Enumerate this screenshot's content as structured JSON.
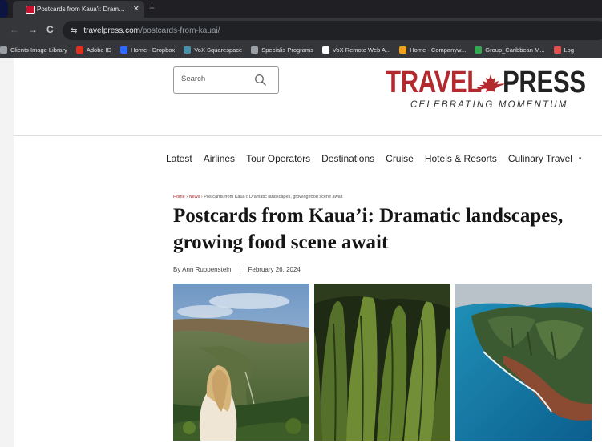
{
  "browser": {
    "tab_title": "Postcards from Kaua'i: Dramatic",
    "tab_close": "✕",
    "new_tab": "+",
    "url_host": "travelpress.com",
    "url_path": "/postcards-from-kauai/",
    "nav_back": "←",
    "nav_forward": "→",
    "nav_reload": "C",
    "site_settings": "⇆",
    "bookmarks": [
      {
        "label": "Clients Image Library",
        "color": "#9aa0a6"
      },
      {
        "label": "Adobe ID",
        "color": "#e0311f"
      },
      {
        "label": "Home - Dropbox",
        "color": "#2f6bff"
      },
      {
        "label": "VoX Squarespace",
        "color": "#4a8fa8"
      },
      {
        "label": "Specialis Programs",
        "color": "#9aa0a6"
      },
      {
        "label": "VoX Remote Web A...",
        "color": "#ffffff"
      },
      {
        "label": "Home - Companyw...",
        "color": "#f0a020"
      },
      {
        "label": "Group_Caribbean M...",
        "color": "#34a853"
      },
      {
        "label": "Log",
        "color": "#e05050"
      }
    ]
  },
  "site": {
    "search_placeholder": "Search",
    "logo": {
      "word1": "TRAVEL",
      "word2": "PRESS",
      "tagline": "CELEBRATING MOMENTUM",
      "brand_red": "#b22a2e"
    },
    "nav": [
      "Latest",
      "Airlines",
      "Tour Operators",
      "Destinations",
      "Cruise",
      "Hotels & Resorts",
      "Culinary Travel"
    ],
    "nav_more": "▾",
    "breadcrumb": {
      "home": "Home",
      "sep1": " › ",
      "news": "News",
      "sep2": " › ",
      "current": "Postcards from Kaua'i: Dramatic landscapes, growing food scene await"
    },
    "headline": "Postcards from Kaua’i: Dramatic landscapes, growing food scene await",
    "byline": {
      "author": "By Ann Ruppenstein",
      "date": "February 26, 2024"
    }
  }
}
